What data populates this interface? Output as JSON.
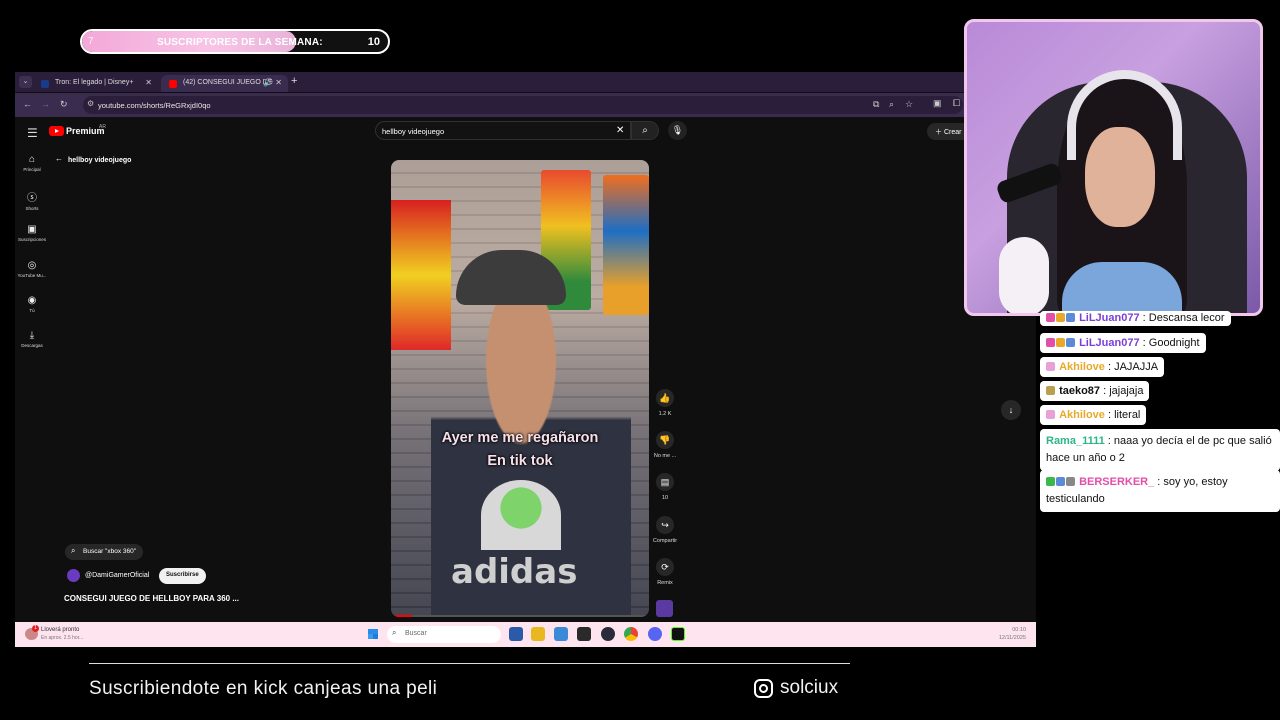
{
  "sub_goal": {
    "count_left": "7",
    "label": "SUSCRIPTORES DE LA SEMANA:",
    "target": "10",
    "progress_fraction": 0.7
  },
  "browser": {
    "tabs": [
      {
        "title": "Tron: El legado | Disney+",
        "active": false
      },
      {
        "title": "(42) CONSEGUI JUEGO DE",
        "active": true
      }
    ],
    "new_tab": "+",
    "url": "youtube.com/shorts/ReGRxjdI0qo"
  },
  "youtube": {
    "brand": "Premium",
    "country": "AR",
    "search_value": "hellboy videojuego",
    "create_label": "Crear",
    "sidebar": [
      {
        "icon": "home-icon",
        "label": "Principal"
      },
      {
        "icon": "shorts-icon",
        "label": "Shorts"
      },
      {
        "icon": "subscriptions-icon",
        "label": "Suscripciones"
      },
      {
        "icon": "youtube-music-icon",
        "label": "YouTube Mu..."
      },
      {
        "icon": "you-icon",
        "label": "Tú"
      },
      {
        "icon": "downloads-icon",
        "label": "Descargas"
      }
    ],
    "back_label": "hellboy videojuego",
    "video": {
      "caption_line1": "Ayer me me regañaron",
      "caption_line2": "En tik tok",
      "shirt_text": "adidas"
    },
    "actions": [
      {
        "icon": "like-icon",
        "label": "1.2 K"
      },
      {
        "icon": "dislike-icon",
        "label": "No me ..."
      },
      {
        "icon": "comment-icon",
        "label": "10"
      },
      {
        "icon": "share-icon",
        "label": "Compartir"
      },
      {
        "icon": "remix-icon",
        "label": "Remix"
      }
    ],
    "search_chip": "Buscar \"xbox 360\"",
    "channel": "@DamiGamerOficial",
    "subscribe_label": "Suscribirse",
    "video_title": "CONSEGUI JUEGO DE HELLBOY PARA 360 ..."
  },
  "taskbar": {
    "notif_count": "1",
    "weather_line1": "Lloverá pronto",
    "weather_line2": "En aprox. 2.5 hor...",
    "search_placeholder": "Buscar",
    "time": "00:10",
    "date": "12/11/2025"
  },
  "chat": [
    {
      "user": "LiLJuan077",
      "message": "Descansa lecor",
      "user_color": "#7b3fd6"
    },
    {
      "user": "LiLJuan077",
      "message": "Goodnight",
      "user_color": "#7b3fd6"
    },
    {
      "user": "Akhilove",
      "message": "JAJAJJA",
      "user_color": "#e8a82a"
    },
    {
      "user": "taeko87",
      "message": "jajajaja",
      "user_color": "#111111"
    },
    {
      "user": "Akhilove",
      "message": "literal",
      "user_color": "#e8a82a"
    },
    {
      "user": "Rama_1111",
      "message": "naaa yo decía el de pc que salió hace un año o 2",
      "user_color": "#2bb68a"
    },
    {
      "user": "BERSERKER_",
      "message": "soy yo, estoy testiculando",
      "user_color": "#e24fa8"
    }
  ],
  "overlay": {
    "banner": "Suscribiendote en kick canjeas una peli",
    "instagram": "solciux"
  },
  "colors": {
    "accent_pink": "#f2c7ec",
    "youtube_red": "#ff0000",
    "taskbar_pink": "#fde4ef"
  }
}
